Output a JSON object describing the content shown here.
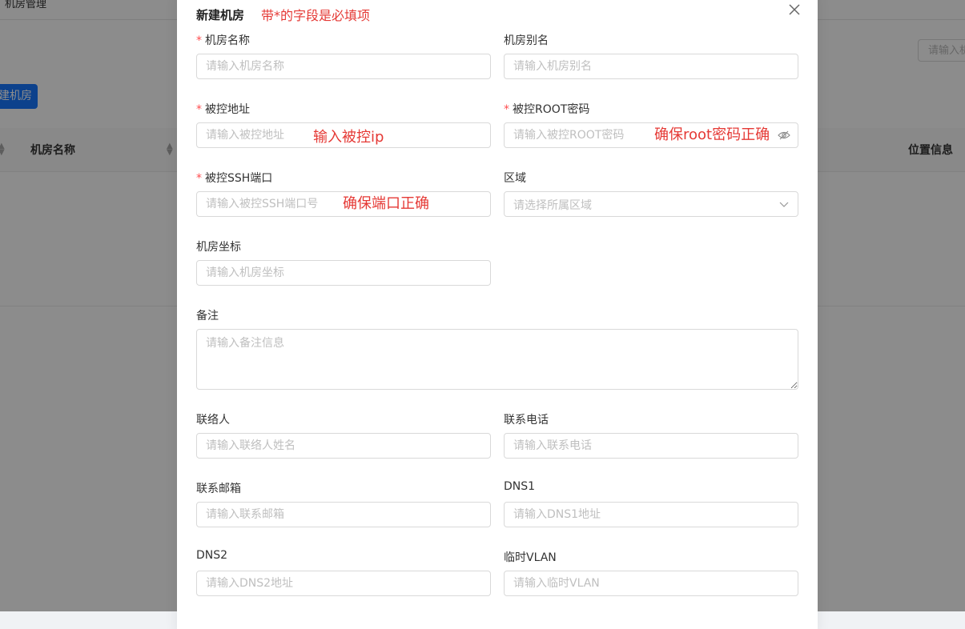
{
  "background": {
    "breadcrumb": "机房管理",
    "search_placeholder": "请输入机",
    "new_button": "建机房",
    "table_headers": {
      "name": "机房名称",
      "location": "位置信息"
    }
  },
  "modal": {
    "title": "新建机房",
    "title_annotation": "带*的字段是必填项",
    "fields": {
      "name": {
        "required": "*",
        "label": "机房名称",
        "placeholder": "请输入机房名称"
      },
      "alias": {
        "label": "机房别名",
        "placeholder": "请输入机房别名"
      },
      "address": {
        "required": "*",
        "label": "被控地址",
        "placeholder": "请输入被控地址",
        "annotation": "输入被控ip"
      },
      "root_password": {
        "required": "*",
        "label": "被控ROOT密码",
        "placeholder": "请输入被控ROOT密码",
        "annotation": "确保root密码正确"
      },
      "ssh_port": {
        "required": "*",
        "label": "被控SSH端口",
        "placeholder": "请输入被控SSH端口号",
        "annotation": "确保端口正确"
      },
      "region": {
        "label": "区域",
        "placeholder": "请选择所属区域"
      },
      "coordinates": {
        "label": "机房坐标",
        "placeholder": "请输入机房坐标"
      },
      "remarks": {
        "label": "备注",
        "placeholder": "请输入备注信息"
      },
      "contact": {
        "label": "联络人",
        "placeholder": "请输入联络人姓名"
      },
      "phone": {
        "label": "联系电话",
        "placeholder": "请输入联系电话"
      },
      "email": {
        "label": "联系邮箱",
        "placeholder": "请输入联系邮箱"
      },
      "dns1": {
        "label": "DNS1",
        "placeholder": "请输入DNS1地址"
      },
      "dns2": {
        "label": "DNS2",
        "placeholder": "请输入DNS2地址"
      },
      "temp_vlan": {
        "label": "临时VLAN",
        "placeholder": "请输入临时VLAN"
      }
    }
  },
  "colors": {
    "required_star": "#ff4d4f",
    "annotation_red": "#e53935",
    "primary_blue": "#1677ff",
    "placeholder": "#bfbfbf",
    "border": "#d9d9d9"
  },
  "icons": {
    "close": "close-icon",
    "password_toggle": "eye-icon",
    "select_arrow": "chevron-down-icon",
    "sort": "sort-icon"
  }
}
